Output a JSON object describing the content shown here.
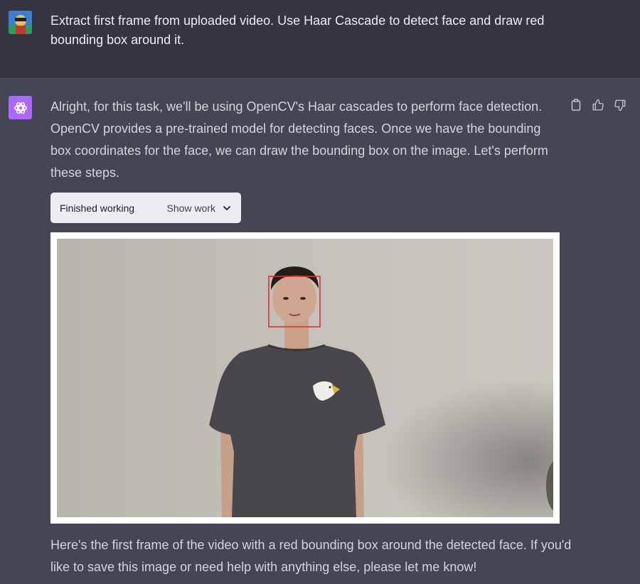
{
  "user_message": {
    "avatar_icon": "user-avatar-icon",
    "text": "Extract first frame from uploaded video. Use Haar Cascade to detect face and draw red bounding box around it."
  },
  "assistant_message": {
    "avatar_icon": "openai-logo-icon",
    "avatar_color": "#ab68ff",
    "intro": "Alright, for this task, we'll be using OpenCV's Haar cascades to perform face detection. OpenCV provides a pre-trained model for detecting faces. Once we have the bounding box coordinates for the face, we can draw the bounding box on the image. Let's perform these steps.",
    "work_status": "Finished working",
    "show_work_label": "Show work",
    "result_image": "first-frame-with-red-face-bounding-box",
    "bounding_box_color": "#e0302a",
    "followup": "Here's the first frame of the video with a red bounding box around the detected face. If you'd like to save this image or need help with anything else, please let me know!",
    "actions": [
      "copy-icon",
      "thumbs-up-icon",
      "thumbs-down-icon"
    ]
  }
}
